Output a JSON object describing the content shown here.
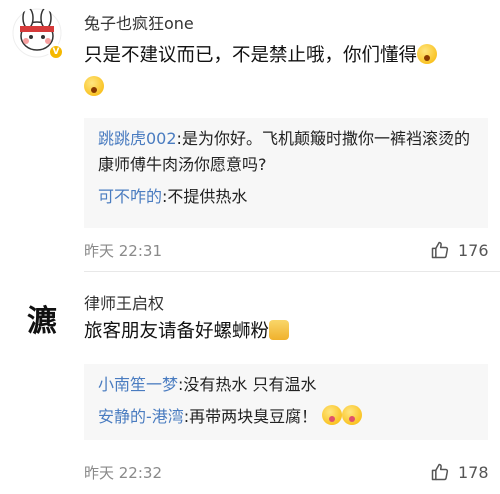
{
  "comments": [
    {
      "username": "兔子也疯狂one",
      "text": "只是不建议而已，不是禁止哦，你们懂得",
      "replies": [
        {
          "name": "跳跳虎002",
          "text": ":是为你好。飞机颠簸时撒你一裤裆滚烫的康师傅牛肉汤你愿意吗?"
        },
        {
          "name": "可不咋的",
          "text": ":不提供热水"
        }
      ],
      "time": "昨天 22:31",
      "likes": "176"
    },
    {
      "username": "律师王启权",
      "avatar_glyph": "瀌",
      "text": "旅客朋友请备好螺蛳粉",
      "replies": [
        {
          "name": "小南笙一梦",
          "text": ":没有热水 只有温水"
        },
        {
          "name": "安静的-港湾",
          "text": ":再带两块臭豆腐！"
        }
      ],
      "time": "昨天 22:32",
      "likes": "178"
    }
  ],
  "icons": {
    "like": "thumbs-up-icon",
    "verified": "verified-badge-icon"
  },
  "colors": {
    "reply_name": "#4a7cc0",
    "badge": "#f5b800"
  }
}
